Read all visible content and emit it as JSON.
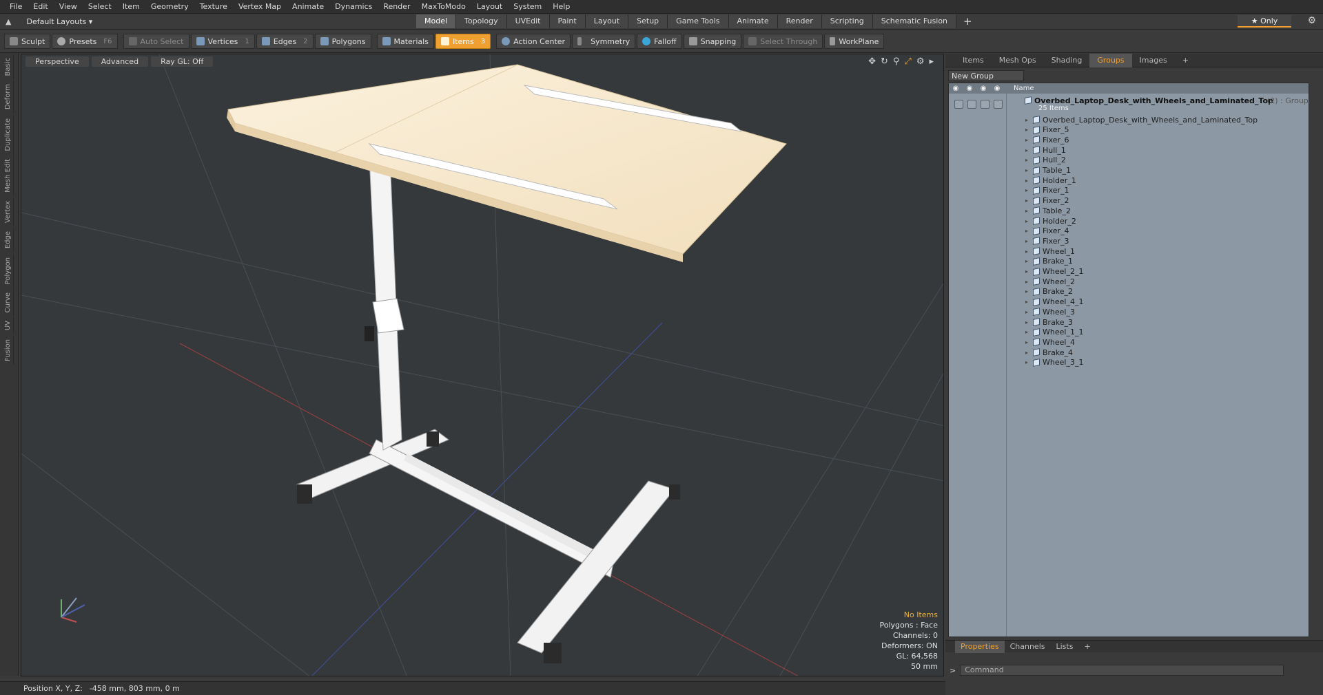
{
  "menu": [
    "File",
    "Edit",
    "View",
    "Select",
    "Item",
    "Geometry",
    "Texture",
    "Vertex Map",
    "Animate",
    "Dynamics",
    "Render",
    "MaxToModo",
    "Layout",
    "System",
    "Help"
  ],
  "layout_selector": "Default Layouts ▾",
  "mode_tabs": [
    "Model",
    "Topology",
    "UVEdit",
    "Paint",
    "Layout",
    "Setup",
    "Game Tools",
    "Animate",
    "Render",
    "Scripting",
    "Schematic Fusion"
  ],
  "active_mode": "Model",
  "only_label": "★  Only",
  "toolbar": {
    "sculpt": "Sculpt",
    "presets": "Presets",
    "presets_shortcut": "F6",
    "auto_select": "Auto Select",
    "vertices": "Vertices",
    "vertices_count": "1",
    "edges": "Edges",
    "edges_count": "2",
    "polygons": "Polygons",
    "materials": "Materials",
    "items": "Items",
    "items_count": "3",
    "action_center": "Action Center",
    "symmetry": "Symmetry",
    "falloff": "Falloff",
    "snapping": "Snapping",
    "select_through": "Select Through",
    "workplane": "WorkPlane"
  },
  "left_tabs": [
    "Basic",
    "Deform",
    "Duplicate",
    "Mesh Edit",
    "Vertex",
    "Edge",
    "Polygon",
    "Curve",
    "UV",
    "Fusion"
  ],
  "viewport": {
    "view": "Perspective",
    "advanced": "Advanced",
    "raygl": "Ray GL: Off",
    "stats": {
      "selection": "No Items",
      "polygons": "Polygons : Face",
      "channels": "Channels: 0",
      "deformers": "Deformers: ON",
      "gl": "GL: 64,568",
      "unit": "50 mm"
    }
  },
  "right_tabs": [
    "Items",
    "Mesh Ops",
    "Shading",
    "Groups",
    "Images",
    "+"
  ],
  "right_active": "Groups",
  "new_group": "New Group",
  "list_header": "Name",
  "group": {
    "name": "Overbed_Laptop_Desk_with_Wheels_and_Laminated_Top",
    "count": "(2) : Group",
    "sub": "25 Items"
  },
  "items": [
    "Overbed_Laptop_Desk_with_Wheels_and_Laminated_Top",
    "Fixer_5",
    "Fixer_6",
    "Hull_1",
    "Hull_2",
    "Table_1",
    "Holder_1",
    "Fixer_1",
    "Fixer_2",
    "Table_2",
    "Holder_2",
    "Fixer_4",
    "Fixer_3",
    "Wheel_1",
    "Brake_1",
    "Wheel_2_1",
    "Wheel_2",
    "Brake_2",
    "Wheel_4_1",
    "Wheel_3",
    "Brake_3",
    "Wheel_1_1",
    "Wheel_4",
    "Brake_4",
    "Wheel_3_1"
  ],
  "prop_tabs": [
    "Properties",
    "Channels",
    "Lists",
    "+"
  ],
  "command_placeholder": "Command",
  "status": {
    "label": "Position X, Y, Z:",
    "value": "-458 mm, 803 mm, 0 m"
  }
}
